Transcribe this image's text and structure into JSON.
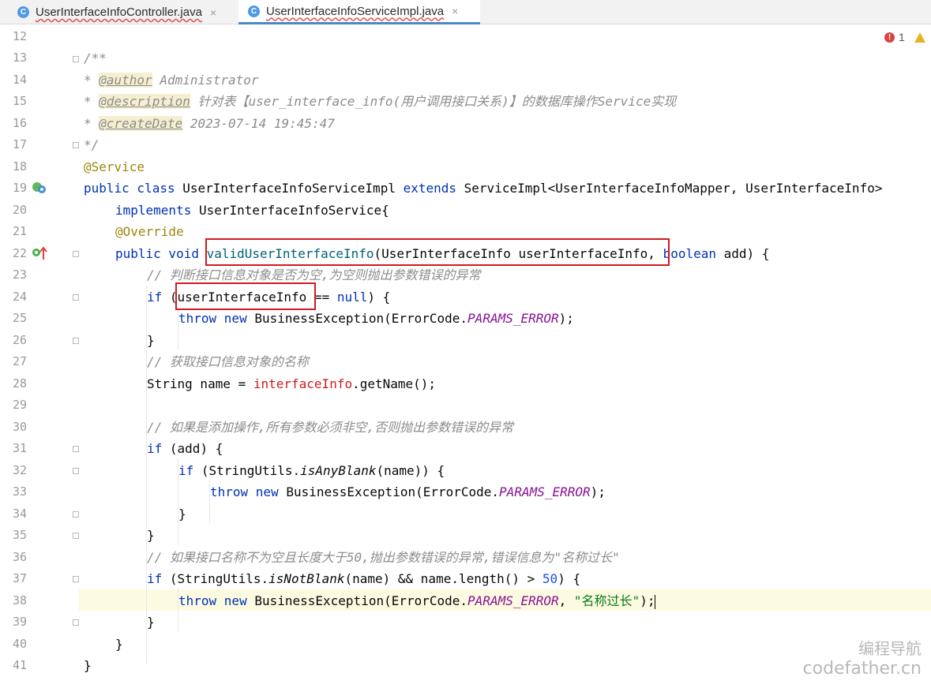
{
  "tabs": [
    {
      "icon": "C",
      "label": "UserInterfaceInfoController.java",
      "close": "×",
      "active": false
    },
    {
      "icon": "C",
      "label": "UserInterfaceInfoServiceImpl.java",
      "close": "×",
      "active": true
    }
  ],
  "inspections": {
    "errors": "1"
  },
  "line_numbers": [
    "12",
    "13",
    "14",
    "15",
    "16",
    "17",
    "18",
    "19",
    "20",
    "21",
    "22",
    "23",
    "24",
    "25",
    "26",
    "27",
    "28",
    "29",
    "30",
    "31",
    "32",
    "33",
    "34",
    "35",
    "36",
    "37",
    "38",
    "39",
    "40",
    "41"
  ],
  "code": {
    "l13": "/**",
    "l14_star": "* ",
    "l14_tag": "@author",
    "l14_text": " Administrator",
    "l15_star": "* ",
    "l15_tag": "@description",
    "l15_text": " 针对表【user_interface_info(用户调用接口关系)】的数据库操作Service实现",
    "l16_star": "* ",
    "l16_tag": "@createDate",
    "l16_text": " 2023-07-14 19:45:47",
    "l17": "*/",
    "l18": "@Service",
    "l19_a": "public class ",
    "l19_b": "UserInterfaceInfoServiceImpl ",
    "l19_c": "extends ",
    "l19_d": "ServiceImpl<UserInterfaceInfoMapper, UserInterfaceInfo>",
    "l20_a": "implements ",
    "l20_b": "UserInterfaceInfoService{",
    "l21": "@Override",
    "l22_a": "public void ",
    "l22_b": "validUserInterfaceInfo",
    "l22_c": "(UserInterfaceInfo userInterfaceInfo, ",
    "l22_d": "boolean ",
    "l22_e": "add) {",
    "l23": "// 判断接口信息对象是否为空,为空则抛出参数错误的异常",
    "l24_a": "if ",
    "l24_b": "(userInterfaceInfo == ",
    "l24_c": "null",
    "l24_d": ") {",
    "l25_a": "throw new ",
    "l25_b": "BusinessException(ErrorCode.",
    "l25_c": "PARAMS_ERROR",
    "l25_d": ");",
    "l26": "}",
    "l27": "// 获取接口信息对象的名称",
    "l28_a": "String name = ",
    "l28_b": "interfaceInfo",
    "l28_c": ".getName();",
    "l30": "// 如果是添加操作,所有参数必须非空,否则抛出参数错误的异常",
    "l31_a": "if ",
    "l31_b": "(add) {",
    "l32_a": "if ",
    "l32_b": "(StringUtils.",
    "l32_c": "isAnyBlank",
    "l32_d": "(name)) {",
    "l33_a": "throw new ",
    "l33_b": "BusinessException(ErrorCode.",
    "l33_c": "PARAMS_ERROR",
    "l33_d": ");",
    "l34": "}",
    "l35": "}",
    "l36": "// 如果接口名称不为空且长度大于50,抛出参数错误的异常,错误信息为\"名称过长\"",
    "l37_a": "if ",
    "l37_b": "(StringUtils.",
    "l37_c": "isNotBlank",
    "l37_d": "(name) && name.length() > ",
    "l37_e": "50",
    "l37_f": ") {",
    "l38_a": "throw new ",
    "l38_b": "BusinessException(ErrorCode.",
    "l38_c": "PARAMS_ERROR",
    "l38_d": ", ",
    "l38_e": "\"名称过长\"",
    "l38_f": ");",
    "l39": "}",
    "l40": "}",
    "l41": "}"
  },
  "watermark": {
    "line1": "编程导航",
    "line2": "codefather.cn"
  },
  "colors": {
    "keyword": "#0033b3",
    "annotation": "#9e880d",
    "comment": "#8c8c8c",
    "method": "#00627a",
    "constant": "#871094",
    "string": "#067d17",
    "number": "#1750eb",
    "highlight_box": "#d1191f"
  }
}
